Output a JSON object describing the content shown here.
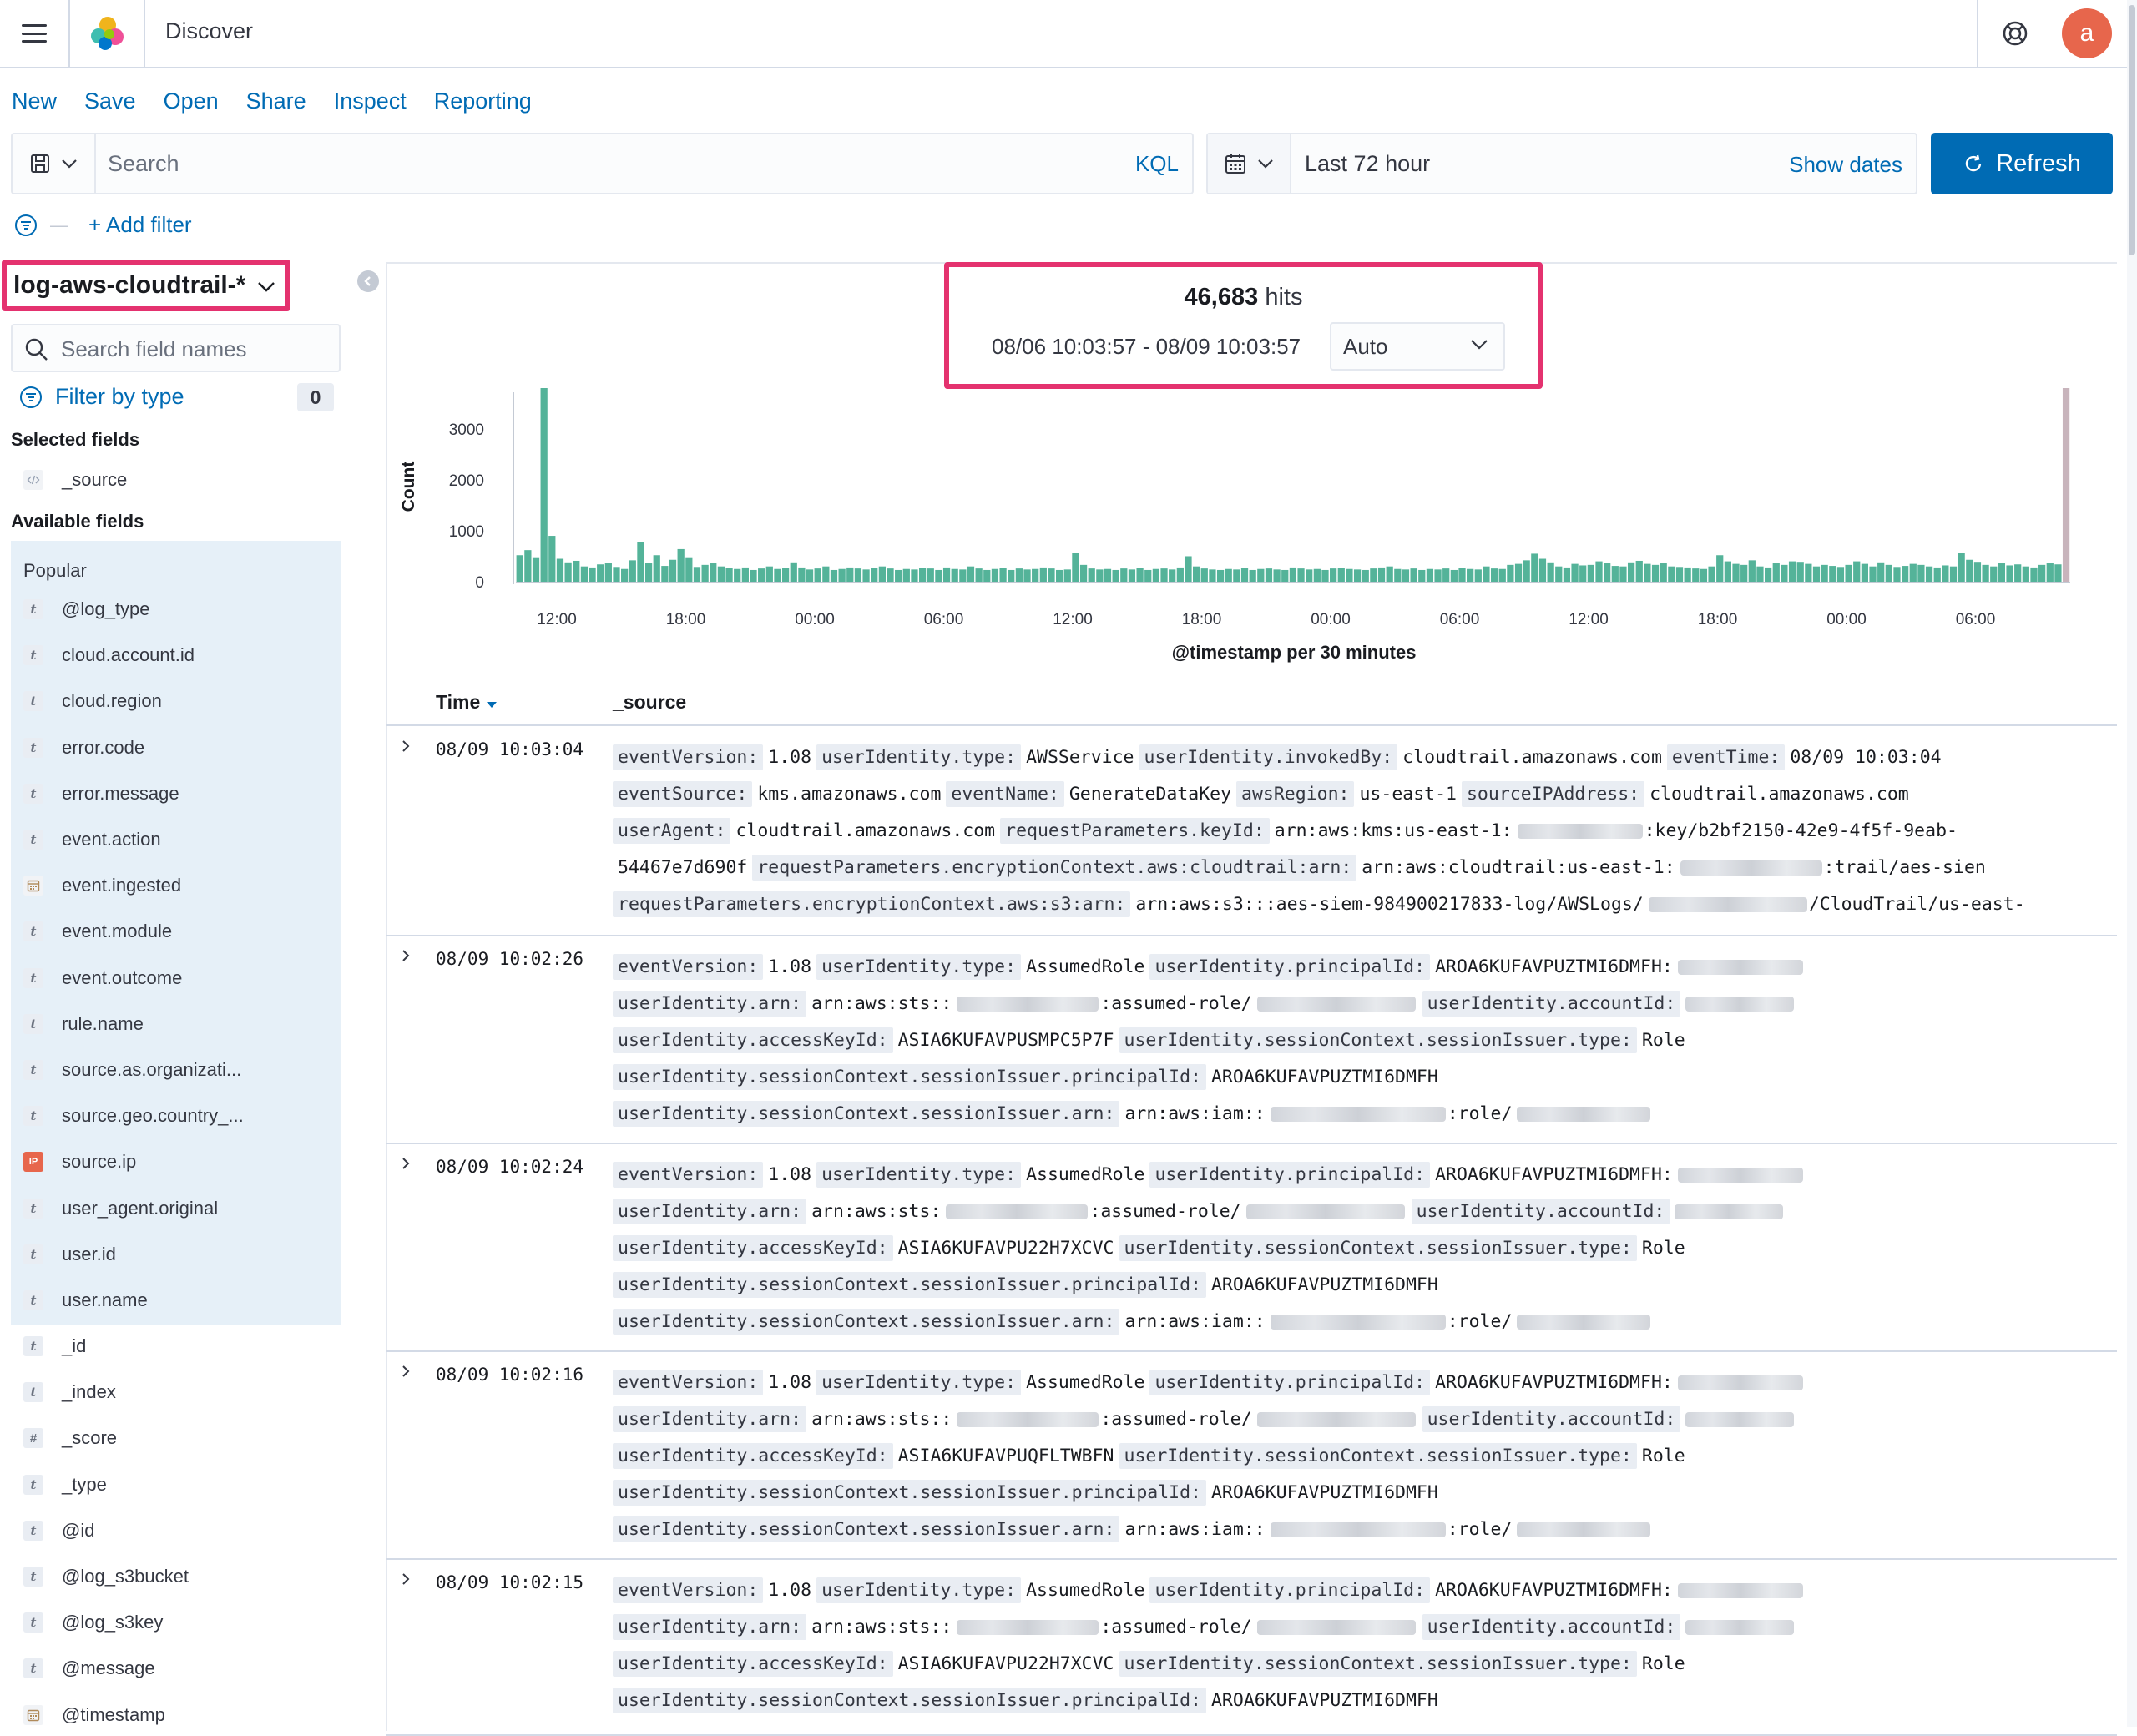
{
  "header": {
    "title": "Discover",
    "avatar_letter": "a"
  },
  "topnav": [
    "New",
    "Save",
    "Open",
    "Share",
    "Inspect",
    "Reporting"
  ],
  "query": {
    "placeholder": "Search",
    "language": "KQL"
  },
  "time": {
    "range": "Last 72 hour",
    "show_dates": "Show dates",
    "refresh": "Refresh"
  },
  "filters": {
    "add_filter": "+ Add filter"
  },
  "sidebar": {
    "index_pattern": "log-aws-cloudtrail-*",
    "field_search_placeholder": "Search field names",
    "filter_by_type": "Filter by type",
    "filter_count": "0",
    "selected_title": "Selected fields",
    "available_title": "Available fields",
    "popular_title": "Popular",
    "selected_fields": [
      {
        "type": "code",
        "name": "_source"
      }
    ],
    "popular_fields": [
      {
        "type": "t",
        "name": "@log_type"
      },
      {
        "type": "t",
        "name": "cloud.account.id"
      },
      {
        "type": "t",
        "name": "cloud.region"
      },
      {
        "type": "t",
        "name": "error.code"
      },
      {
        "type": "t",
        "name": "error.message"
      },
      {
        "type": "t",
        "name": "event.action"
      },
      {
        "type": "date",
        "name": "event.ingested"
      },
      {
        "type": "t",
        "name": "event.module"
      },
      {
        "type": "t",
        "name": "event.outcome"
      },
      {
        "type": "t",
        "name": "rule.name"
      },
      {
        "type": "t",
        "name": "source.as.organizati..."
      },
      {
        "type": "t",
        "name": "source.geo.country_..."
      },
      {
        "type": "ip",
        "name": "source.ip"
      },
      {
        "type": "t",
        "name": "user_agent.original"
      },
      {
        "type": "t",
        "name": "user.id"
      },
      {
        "type": "t",
        "name": "user.name"
      }
    ],
    "other_fields": [
      {
        "type": "t",
        "name": "_id"
      },
      {
        "type": "t",
        "name": "_index"
      },
      {
        "type": "num",
        "name": "_score"
      },
      {
        "type": "t",
        "name": "_type"
      },
      {
        "type": "t",
        "name": "@id"
      },
      {
        "type": "t",
        "name": "@log_s3bucket"
      },
      {
        "type": "t",
        "name": "@log_s3key"
      },
      {
        "type": "t",
        "name": "@message"
      },
      {
        "type": "date",
        "name": "@timestamp"
      }
    ]
  },
  "hits": {
    "count": "46,683",
    "label": "hits",
    "range": "08/06 10:03:57 - 08/09 10:03:57",
    "interval": "Auto"
  },
  "chart_data": {
    "type": "bar",
    "ylabel": "Count",
    "xlabel": "@timestamp per 30 minutes",
    "yticks": [
      0,
      1000,
      2000,
      3000
    ],
    "ylim": [
      0,
      3800
    ],
    "xticks": [
      "12:00",
      "18:00",
      "00:00",
      "06:00",
      "12:00",
      "18:00",
      "00:00",
      "06:00",
      "12:00",
      "18:00",
      "00:00",
      "06:00"
    ],
    "bar_color": "#54b399",
    "values": [
      520,
      620,
      480,
      3800,
      900,
      450,
      380,
      410,
      300,
      280,
      340,
      360,
      290,
      250,
      420,
      780,
      360,
      520,
      310,
      430,
      640,
      480,
      290,
      330,
      360,
      300,
      270,
      250,
      280,
      230,
      260,
      300,
      250,
      270,
      380,
      280,
      240,
      260,
      300,
      230,
      250,
      280,
      260,
      240,
      270,
      300,
      260,
      230,
      250,
      240,
      270,
      260,
      230,
      280,
      250,
      240,
      300,
      260,
      230,
      250,
      270,
      230,
      260,
      240,
      250,
      280,
      260,
      230,
      240,
      570,
      330,
      260,
      240,
      250,
      230,
      260,
      240,
      270,
      230,
      250,
      260,
      240,
      280,
      500,
      300,
      260,
      240,
      230,
      250,
      240,
      270,
      230,
      250,
      260,
      240,
      230,
      280,
      260,
      240,
      250,
      230,
      260,
      270,
      250,
      240,
      230,
      260,
      280,
      300,
      250,
      240,
      260,
      230,
      250,
      240,
      260,
      230,
      270,
      250,
      240,
      300,
      260,
      250,
      330,
      350,
      420,
      550,
      450,
      380,
      300,
      280,
      350,
      320,
      330,
      400,
      360,
      310,
      300,
      380,
      410,
      350,
      330,
      360,
      300,
      290,
      280,
      260,
      250,
      300,
      520,
      400,
      350,
      330,
      420,
      300,
      280,
      360,
      330,
      400,
      390,
      350,
      300,
      330,
      310,
      290,
      330,
      400,
      350,
      300,
      380,
      330,
      290,
      310,
      350,
      330,
      300,
      280,
      320,
      300,
      560,
      430,
      390,
      330,
      300,
      360,
      320,
      340,
      300,
      280,
      330,
      360,
      340,
      3800
    ]
  },
  "table": {
    "col_time": "Time",
    "col_source": "_source",
    "rows": [
      {
        "time": "08/09 10:03:04",
        "lines": [
          [
            [
              "eventVersion:",
              "1.08"
            ],
            [
              "userIdentity.type:",
              "AWSService"
            ],
            [
              "userIdentity.invokedBy:",
              "cloudtrail.amazonaws.com"
            ],
            [
              "eventTime:",
              "08/09 10:03:04"
            ]
          ],
          [
            [
              "eventSource:",
              "kms.amazonaws.com"
            ],
            [
              "eventName:",
              "GenerateDataKey"
            ],
            [
              "awsRegion:",
              "us-east-1"
            ],
            [
              "sourceIPAddress:",
              "cloudtrail.amazonaws.com"
            ]
          ],
          [
            [
              "userAgent:",
              "cloudtrail.amazonaws.com"
            ],
            [
              "requestParameters.keyId:",
              "arn:aws:kms:us-east-1:",
              ":key/b2bf2150-42e9-4f5f-9eab-"
            ]
          ],
          [
            [
              "",
              "54467e7d690f"
            ],
            [
              "requestParameters.encryptionContext.aws:cloudtrail:arn:",
              "arn:aws:cloudtrail:us-east-1:",
              ":trail/aes-sien"
            ]
          ],
          [
            [
              "requestParameters.encryptionContext.aws:s3:arn:",
              "arn:aws:s3:::aes-siem-984900217833-log/AWSLogs/",
              "/CloudTrail/us-east-"
            ]
          ]
        ]
      },
      {
        "time": "08/09 10:02:26",
        "lines": [
          [
            [
              "eventVersion:",
              "1.08"
            ],
            [
              "userIdentity.type:",
              "AssumedRole"
            ],
            [
              "userIdentity.principalId:",
              "AROA6KUFAVPUZTMI6DMFH:",
              ""
            ]
          ],
          [
            [
              "userIdentity.arn:",
              "arn:aws:sts::",
              ":assumed-role/",
              ""
            ],
            [
              "userIdentity.accountId:",
              ""
            ]
          ],
          [
            [
              "userIdentity.accessKeyId:",
              "ASIA6KUFAVPUSMPC5P7F"
            ],
            [
              "userIdentity.sessionContext.sessionIssuer.type:",
              "Role"
            ]
          ],
          [
            [
              "userIdentity.sessionContext.sessionIssuer.principalId:",
              "AROA6KUFAVPUZTMI6DMFH"
            ]
          ],
          [
            [
              "userIdentity.sessionContext.sessionIssuer.arn:",
              "arn:aws:iam::",
              ":role/",
              ""
            ]
          ]
        ]
      },
      {
        "time": "08/09 10:02:24",
        "lines": [
          [
            [
              "eventVersion:",
              "1.08"
            ],
            [
              "userIdentity.type:",
              "AssumedRole"
            ],
            [
              "userIdentity.principalId:",
              "AROA6KUFAVPUZTMI6DMFH:",
              ""
            ]
          ],
          [
            [
              "userIdentity.arn:",
              "arn:aws:sts:",
              ":assumed-role/",
              ""
            ],
            [
              "userIdentity.accountId:",
              ""
            ]
          ],
          [
            [
              "userIdentity.accessKeyId:",
              "ASIA6KUFAVPU22H7XCVC"
            ],
            [
              "userIdentity.sessionContext.sessionIssuer.type:",
              "Role"
            ]
          ],
          [
            [
              "userIdentity.sessionContext.sessionIssuer.principalId:",
              "AROA6KUFAVPUZTMI6DMFH"
            ]
          ],
          [
            [
              "userIdentity.sessionContext.sessionIssuer.arn:",
              "arn:aws:iam::",
              ":role/",
              ""
            ]
          ]
        ]
      },
      {
        "time": "08/09 10:02:16",
        "lines": [
          [
            [
              "eventVersion:",
              "1.08"
            ],
            [
              "userIdentity.type:",
              "AssumedRole"
            ],
            [
              "userIdentity.principalId:",
              "AROA6KUFAVPUZTMI6DMFH:",
              ""
            ]
          ],
          [
            [
              "userIdentity.arn:",
              "arn:aws:sts::",
              ":assumed-role/",
              ""
            ],
            [
              "userIdentity.accountId:",
              ""
            ]
          ],
          [
            [
              "userIdentity.accessKeyId:",
              "ASIA6KUFAVPUQFLTWBFN"
            ],
            [
              "userIdentity.sessionContext.sessionIssuer.type:",
              "Role"
            ]
          ],
          [
            [
              "userIdentity.sessionContext.sessionIssuer.principalId:",
              "AROA6KUFAVPUZTMI6DMFH"
            ]
          ],
          [
            [
              "userIdentity.sessionContext.sessionIssuer.arn:",
              "arn:aws:iam::",
              ":role/",
              ""
            ]
          ]
        ]
      },
      {
        "time": "08/09 10:02:15",
        "lines": [
          [
            [
              "eventVersion:",
              "1.08"
            ],
            [
              "userIdentity.type:",
              "AssumedRole"
            ],
            [
              "userIdentity.principalId:",
              "AROA6KUFAVPUZTMI6DMFH:",
              ""
            ]
          ],
          [
            [
              "userIdentity.arn:",
              "arn:aws:sts::",
              ":assumed-role/",
              ""
            ],
            [
              "userIdentity.accountId:",
              ""
            ]
          ],
          [
            [
              "userIdentity.accessKeyId:",
              "ASIA6KUFAVPU22H7XCVC"
            ],
            [
              "userIdentity.sessionContext.sessionIssuer.type:",
              "Role"
            ]
          ],
          [
            [
              "userIdentity.sessionContext.sessionIssuer.principalId:",
              "AROA6KUFAVPUZTMI6DMFH"
            ]
          ]
        ]
      }
    ]
  }
}
